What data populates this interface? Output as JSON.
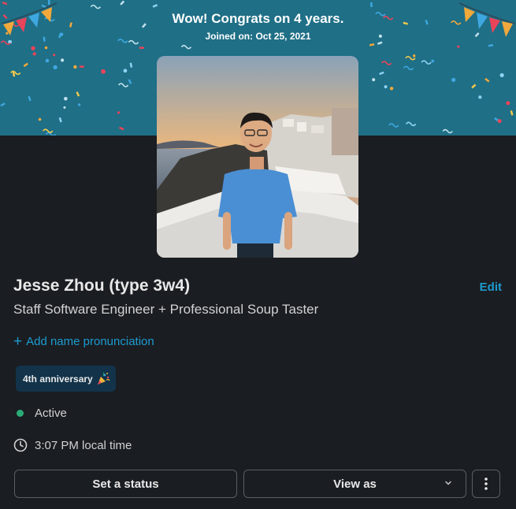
{
  "banner": {
    "title": "Wow! Congrats on 4 years.",
    "subtitle": "Joined on: Oct 25, 2021"
  },
  "profile": {
    "name": "Jesse Zhou (type 3w4)",
    "edit_label": "Edit",
    "title": "Staff Software Engineer + Professional Soup Taster",
    "pronunciation_link": "Add name pronunciation",
    "badge_label": "4th anniversary",
    "badge_icon": "party-popper-icon"
  },
  "status": {
    "presence": "Active",
    "presence_color": "#2bac76",
    "local_time": "3:07 PM local time"
  },
  "actions": {
    "set_status": "Set a status",
    "view_as": "View as"
  },
  "colors": {
    "link": "#1d9bd1",
    "banner_bg": "#1f6f86",
    "background": "#1a1d21",
    "badge_bg": "#12334a"
  }
}
